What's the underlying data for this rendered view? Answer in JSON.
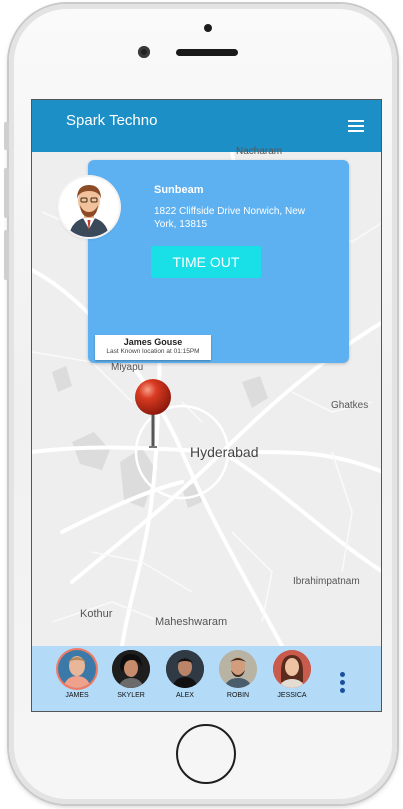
{
  "app": {
    "title": "Spark Techno",
    "accent_color": "#1d8fc7",
    "menu_icon": "hamburger-menu-icon"
  },
  "map": {
    "labels": [
      "Nacharam",
      "Ghatkes",
      "Hyderabad",
      "Ibrahimpatnam",
      "Kothur",
      "Maheshwaram",
      "Miyapu"
    ]
  },
  "info_card": {
    "name": "Sunbeam",
    "address": "1822 Cliffside Drive Norwich, New York, 13815",
    "button_label": "TIME OUT",
    "card_color": "#5eb1f1",
    "button_color": "#19dfe6"
  },
  "marker": {
    "title": "James Gouse",
    "subtitle": "Last Known location at 01:15PM"
  },
  "contacts": [
    {
      "name": "JAMES",
      "selected": true
    },
    {
      "name": "SKYLER",
      "selected": false
    },
    {
      "name": "ALEX",
      "selected": false
    },
    {
      "name": "ROBIN",
      "selected": false
    },
    {
      "name": "JESSICA",
      "selected": false
    }
  ],
  "bottom_bar_color": "#b3daf6",
  "more_icon": "vertical-dots-icon"
}
